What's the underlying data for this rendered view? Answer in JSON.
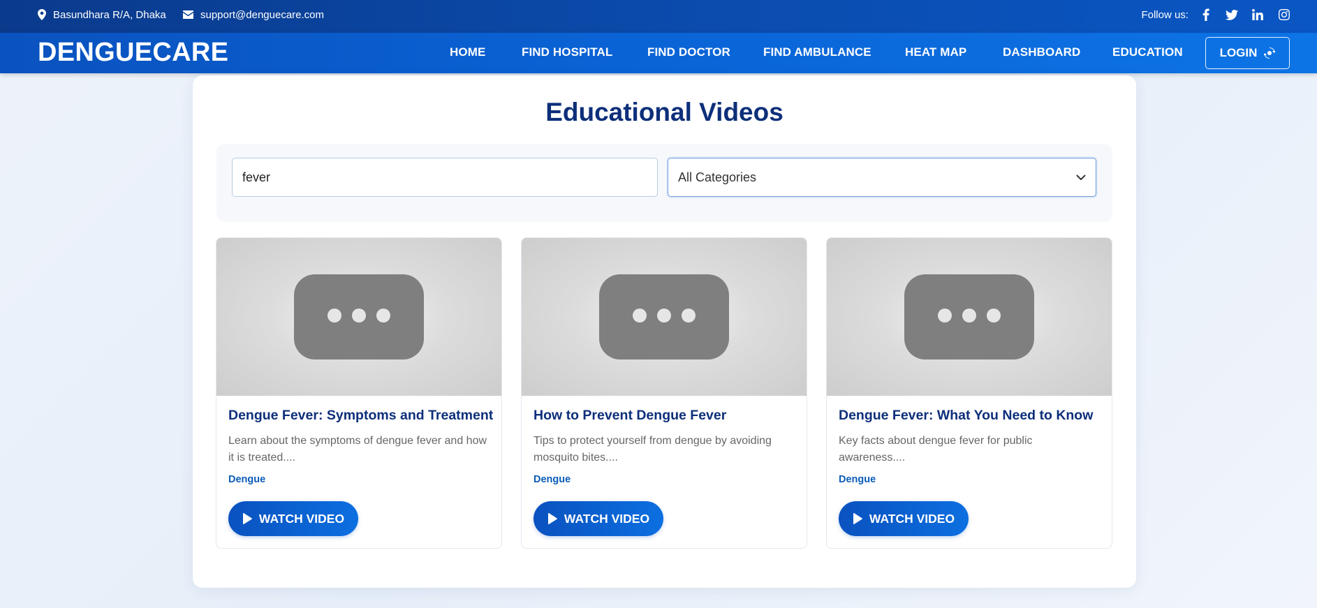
{
  "topbar": {
    "location": "Basundhara R/A, Dhaka",
    "email": "support@denguecare.com",
    "follow_label": "Follow us:",
    "socials": [
      "facebook-icon",
      "twitter-icon",
      "linkedin-icon",
      "instagram-icon"
    ]
  },
  "nav": {
    "brand": "DENGUECARE",
    "items": [
      "HOME",
      "FIND HOSPITAL",
      "FIND DOCTOR",
      "FIND AMBULANCE",
      "HEAT MAP",
      "DASHBOARD",
      "EDUCATION"
    ],
    "login_label": "LOGIN",
    "login_icon": "refresh-icon"
  },
  "main": {
    "title": "Educational Videos",
    "search": {
      "value": "fever"
    },
    "category": {
      "selected": "All Categories"
    },
    "videos": [
      {
        "title": "Dengue Fever: Symptoms and Treatment",
        "description": "Learn about the symptoms of dengue fever and how it is treated....",
        "tag": "Dengue",
        "button": "WATCH VIDEO"
      },
      {
        "title": "How to Prevent Dengue Fever",
        "description": "Tips to protect yourself from dengue by avoiding mosquito bites....",
        "tag": "Dengue",
        "button": "WATCH VIDEO"
      },
      {
        "title": "Dengue Fever: What You Need to Know",
        "description": "Key facts about dengue fever for public awareness....",
        "tag": "Dengue",
        "button": "WATCH VIDEO"
      }
    ]
  },
  "colors": {
    "topbar": "#0a3a8c",
    "navbar": "#0a64d6",
    "title": "#0d2f7a",
    "tag": "#0b5cb8",
    "button": "#0c6fe0"
  }
}
